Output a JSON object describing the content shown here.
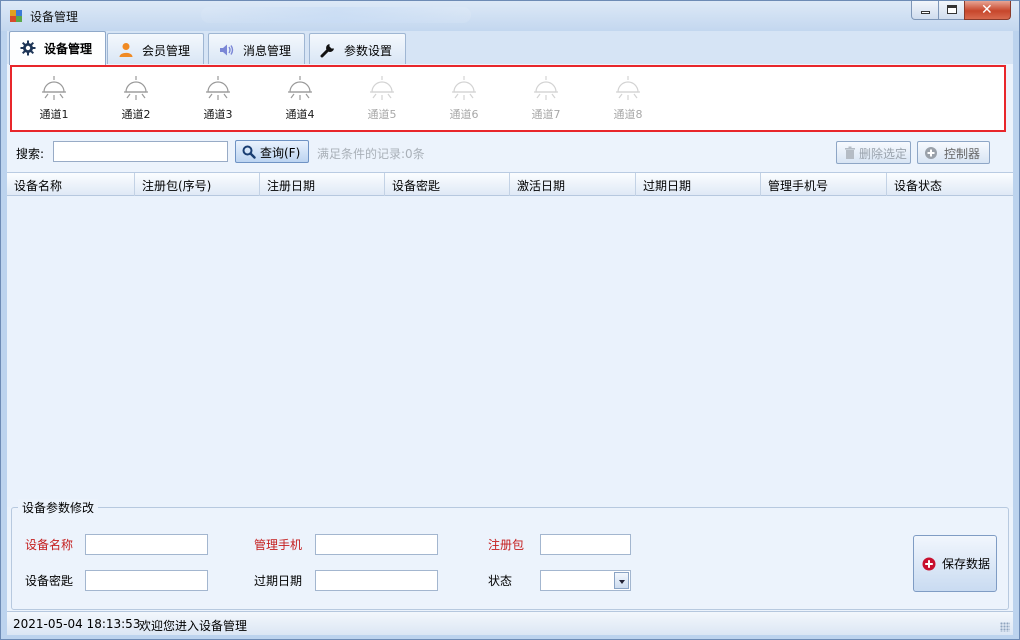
{
  "window": {
    "title": "设备管理",
    "minimize_label": "minimize",
    "maximize_label": "maximize",
    "close_label": "close"
  },
  "tabs": [
    {
      "label": "设备管理",
      "icon": "gear-icon",
      "active": true
    },
    {
      "label": "会员管理",
      "icon": "user-icon",
      "active": false
    },
    {
      "label": "消息管理",
      "icon": "speaker-icon",
      "active": false
    },
    {
      "label": "参数设置",
      "icon": "wrench-icon",
      "active": false
    }
  ],
  "channels": [
    {
      "label": "通道1",
      "icon": "lamp-icon",
      "enabled": true
    },
    {
      "label": "通道2",
      "icon": "lamp-icon",
      "enabled": true
    },
    {
      "label": "通道3",
      "icon": "lamp-icon",
      "enabled": true
    },
    {
      "label": "通道4",
      "icon": "lamp-icon",
      "enabled": true
    },
    {
      "label": "通道5",
      "icon": "lamp-icon",
      "enabled": false
    },
    {
      "label": "通道6",
      "icon": "lamp-icon",
      "enabled": false
    },
    {
      "label": "通道7",
      "icon": "lamp-icon",
      "enabled": false
    },
    {
      "label": "通道8",
      "icon": "lamp-icon",
      "enabled": false
    }
  ],
  "toolbar": {
    "search_label": "搜索:",
    "search_value": "",
    "query_label": "查询(F)",
    "records_text": "满足条件的记录:0条",
    "delete_label": "删除选定",
    "controller_label": "控制器"
  },
  "grid": {
    "columns": [
      "设备名称",
      "注册包(序号)",
      "注册日期",
      "设备密匙",
      "激活日期",
      "过期日期",
      "管理手机号",
      "设备状态"
    ],
    "rows": []
  },
  "edit": {
    "group_title": "设备参数修改",
    "device_name_label": "设备名称",
    "device_name_value": "",
    "phone_label": "管理手机",
    "phone_value": "",
    "reg_package_label": "注册包",
    "reg_package_value": "",
    "device_key_label": "设备密匙",
    "device_key_value": "",
    "expiry_label": "过期日期",
    "expiry_value": "",
    "status_label": "状态",
    "status_value": "",
    "save_label": "保存数据"
  },
  "status": {
    "datetime": "2021-05-04 18:13:53",
    "message": "欢迎您进入设备管理"
  },
  "colors": {
    "highlight_border": "#e8262b",
    "required_label": "#c41d1d",
    "accent": "#2b5fa8"
  }
}
